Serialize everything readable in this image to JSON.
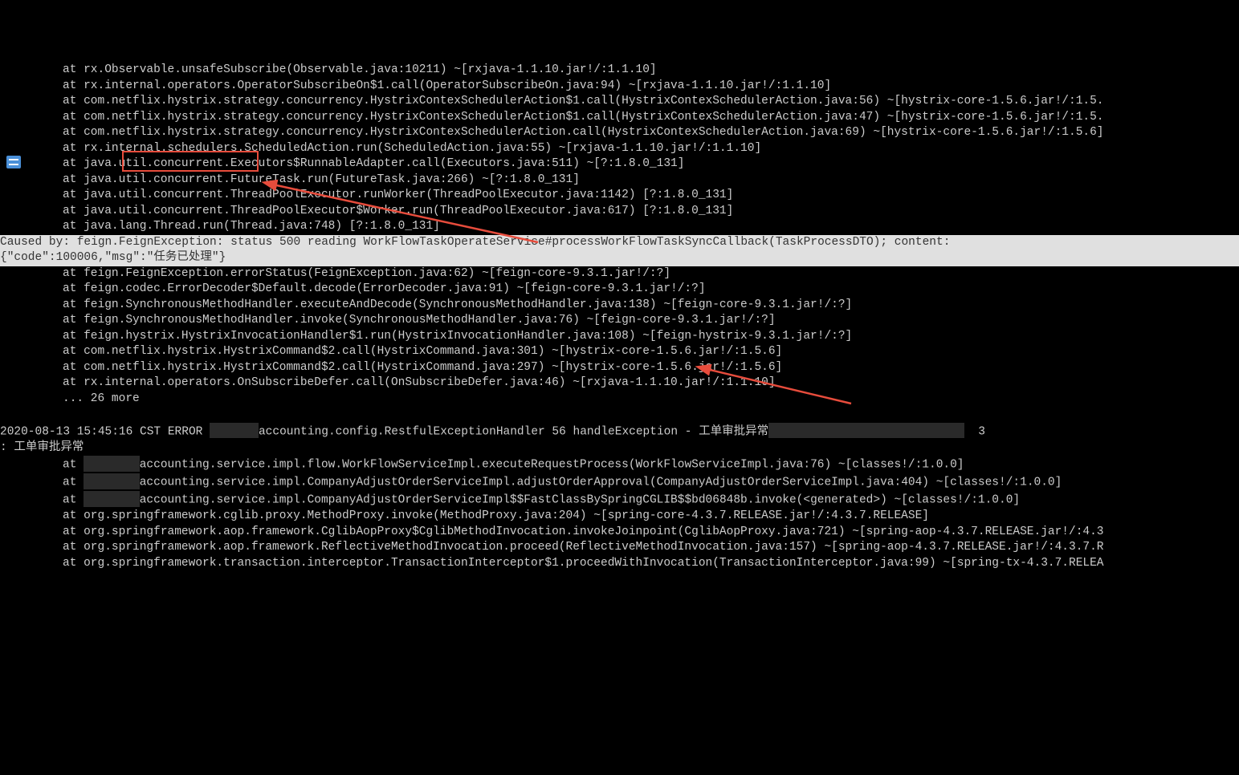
{
  "lines": [
    {
      "type": "trace",
      "text": "at rx.Observable.unsafeSubscribe(Observable.java:10211) ~[rxjava-1.1.10.jar!/:1.1.10]"
    },
    {
      "type": "trace",
      "text": "at rx.internal.operators.OperatorSubscribeOn$1.call(OperatorSubscribeOn.java:94) ~[rxjava-1.1.10.jar!/:1.1.10]"
    },
    {
      "type": "trace",
      "text": "at com.netflix.hystrix.strategy.concurrency.HystrixContexSchedulerAction$1.call(HystrixContexSchedulerAction.java:56) ~[hystrix-core-1.5.6.jar!/:1.5."
    },
    {
      "type": "trace",
      "text": "at com.netflix.hystrix.strategy.concurrency.HystrixContexSchedulerAction$1.call(HystrixContexSchedulerAction.java:47) ~[hystrix-core-1.5.6.jar!/:1.5."
    },
    {
      "type": "trace",
      "text": "at com.netflix.hystrix.strategy.concurrency.HystrixContexSchedulerAction.call(HystrixContexSchedulerAction.java:69) ~[hystrix-core-1.5.6.jar!/:1.5.6]"
    },
    {
      "type": "trace",
      "text": "at rx.internal.schedulers.ScheduledAction.run(ScheduledAction.java:55) ~[rxjava-1.1.10.jar!/:1.1.10]"
    },
    {
      "type": "trace",
      "text": "at java.util.concurrent.Executors$RunnableAdapter.call(Executors.java:511) ~[?:1.8.0_131]"
    },
    {
      "type": "trace",
      "text": "at java.util.concurrent.FutureTask.run(FutureTask.java:266) ~[?:1.8.0_131]"
    },
    {
      "type": "trace",
      "text": "at java.util.concurrent.ThreadPoolExecutor.runWorker(ThreadPoolExecutor.java:1142) [?:1.8.0_131]"
    },
    {
      "type": "trace",
      "text": "at java.util.concurrent.ThreadPoolExecutor$Worker.run(ThreadPoolExecutor.java:617) [?:1.8.0_131]"
    },
    {
      "type": "trace",
      "text": "at java.lang.Thread.run(Thread.java:748) [?:1.8.0_131]"
    },
    {
      "type": "highlight",
      "text": "Caused by: feign.FeignException: status 500 reading WorkFlowTaskOperateService#processWorkFlowTaskSyncCallback(TaskProcessDTO); content:"
    },
    {
      "type": "highlight",
      "text": "{\"code\":100006,\"msg\":\"任务已处理\"}"
    },
    {
      "type": "trace",
      "text": "at feign.FeignException.errorStatus(FeignException.java:62) ~[feign-core-9.3.1.jar!/:?]"
    },
    {
      "type": "trace",
      "text": "at feign.codec.ErrorDecoder$Default.decode(ErrorDecoder.java:91) ~[feign-core-9.3.1.jar!/:?]"
    },
    {
      "type": "trace",
      "text": "at feign.SynchronousMethodHandler.executeAndDecode(SynchronousMethodHandler.java:138) ~[feign-core-9.3.1.jar!/:?]"
    },
    {
      "type": "trace",
      "text": "at feign.SynchronousMethodHandler.invoke(SynchronousMethodHandler.java:76) ~[feign-core-9.3.1.jar!/:?]"
    },
    {
      "type": "trace",
      "text": "at feign.hystrix.HystrixInvocationHandler$1.run(HystrixInvocationHandler.java:108) ~[feign-hystrix-9.3.1.jar!/:?]"
    },
    {
      "type": "trace",
      "text": "at com.netflix.hystrix.HystrixCommand$2.call(HystrixCommand.java:301) ~[hystrix-core-1.5.6.jar!/:1.5.6]"
    },
    {
      "type": "trace",
      "text": "at com.netflix.hystrix.HystrixCommand$2.call(HystrixCommand.java:297) ~[hystrix-core-1.5.6.jar!/:1.5.6]"
    },
    {
      "type": "trace",
      "text": "at rx.internal.operators.OnSubscribeDefer.call(OnSubscribeDefer.java:46) ~[rxjava-1.1.10.jar!/:1.1.10]"
    },
    {
      "type": "more",
      "text": "... 26 more"
    },
    {
      "type": "blank",
      "text": ""
    },
    {
      "type": "ts",
      "prefix": "2020-08-13 15:45:16 CST ERROR ",
      "redact1": "       ",
      "mid": "accounting.config.RestfulExceptionHandler 56 handleException - 工单审批异常",
      "redact2": "                            ",
      "suffix": "  3"
    },
    {
      "type": "colon",
      "text": ": 工单审批异常"
    },
    {
      "type": "trace_r",
      "prefix": "at ",
      "redact": "        ",
      "text": "accounting.service.impl.flow.WorkFlowServiceImpl.executeRequestProcess(WorkFlowServiceImpl.java:76) ~[classes!/:1.0.0]"
    },
    {
      "type": "trace_r",
      "prefix": "at ",
      "redact": "        ",
      "text": "accounting.service.impl.CompanyAdjustOrderServiceImpl.adjustOrderApproval(CompanyAdjustOrderServiceImpl.java:404) ~[classes!/:1.0.0]"
    },
    {
      "type": "trace_r",
      "prefix": "at ",
      "redact": "        ",
      "text": "accounting.service.impl.CompanyAdjustOrderServiceImpl$$FastClassBySpringCGLIB$$bd06848b.invoke(<generated>) ~[classes!/:1.0.0]"
    },
    {
      "type": "trace",
      "text": "at org.springframework.cglib.proxy.MethodProxy.invoke(MethodProxy.java:204) ~[spring-core-4.3.7.RELEASE.jar!/:4.3.7.RELEASE]"
    },
    {
      "type": "trace",
      "text": "at org.springframework.aop.framework.CglibAopProxy$CglibMethodInvocation.invokeJoinpoint(CglibAopProxy.java:721) ~[spring-aop-4.3.7.RELEASE.jar!/:4.3"
    },
    {
      "type": "trace",
      "text": "at org.springframework.aop.framework.ReflectiveMethodInvocation.proceed(ReflectiveMethodInvocation.java:157) ~[spring-aop-4.3.7.RELEASE.jar!/:4.3.7.R"
    },
    {
      "type": "trace",
      "text": "at org.springframework.transaction.interceptor.TransactionInterceptor$1.proceedWithInvocation(TransactionInterceptor.java:99) ~[spring-tx-4.3.7.RELEA"
    }
  ],
  "annotations": {
    "box_label": "feign.FeignException",
    "arrow1": "arrow-to-json",
    "arrow2": "arrow-to-error"
  }
}
